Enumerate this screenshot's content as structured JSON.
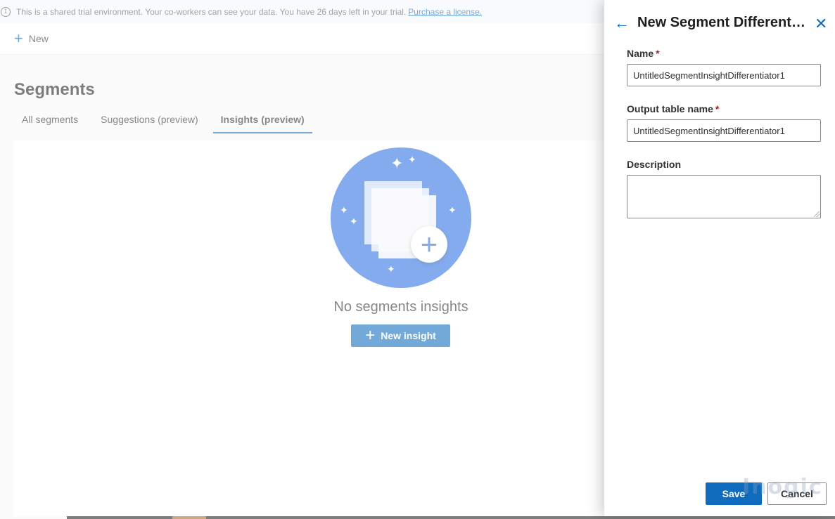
{
  "banner": {
    "text": "This is a shared trial environment. Your co-workers can see your data. You have 26 days left in your trial.",
    "link": "Purchase a license."
  },
  "commandbar": {
    "new_label": "New"
  },
  "page": {
    "title": "Segments",
    "tabs": [
      {
        "label": "All segments",
        "active": false
      },
      {
        "label": "Suggestions (preview)",
        "active": false
      },
      {
        "label": "Insights (preview)",
        "active": true
      }
    ],
    "empty_state": {
      "title": "No segments insights",
      "button_label": "New insight"
    }
  },
  "panel": {
    "title": "New Segment Differentiator",
    "name_label": "Name",
    "name_value": "UntitledSegmentInsightDifferentiator1",
    "output_label": "Output table name",
    "output_value": "UntitledSegmentInsightDifferentiator1",
    "description_label": "Description",
    "description_value": "",
    "save_label": "Save",
    "cancel_label": "Cancel",
    "watermark": "Inogic"
  },
  "colors": {
    "accent": "#0f6cbd",
    "hero": "#2b6fe0",
    "required": "#a4262c"
  },
  "icons": [
    "info-icon",
    "plus-icon",
    "back-arrow-icon",
    "close-icon",
    "sparkle-icon"
  ]
}
